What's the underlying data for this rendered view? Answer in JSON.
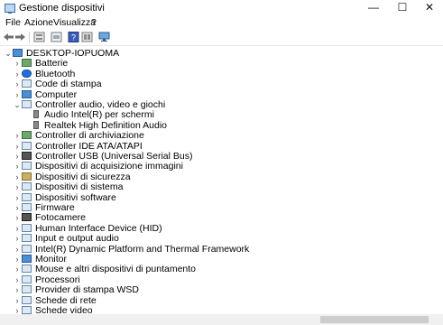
{
  "window": {
    "title": "Gestione dispositivi",
    "buttons": {
      "minimize": "—",
      "maximize": "☐",
      "close": "✕"
    }
  },
  "menu": [
    "File",
    "Azione",
    "Visualizza",
    "?"
  ],
  "toolbar": [
    "back-icon",
    "forward-icon",
    "properties-icon",
    "update-driver-icon",
    "help-icon",
    "view-icon",
    "monitor-icon"
  ],
  "tree": {
    "root": "DESKTOP-IOPUOMA",
    "items": [
      {
        "label": "Batterie",
        "expanded": false,
        "icon": "battery-icon"
      },
      {
        "label": "Bluetooth",
        "expanded": false,
        "icon": "bluetooth-icon"
      },
      {
        "label": "Code di stampa",
        "expanded": false,
        "icon": "print-queue-icon"
      },
      {
        "label": "Computer",
        "expanded": false,
        "icon": "computer-icon"
      },
      {
        "label": "Controller audio, video e giochi",
        "expanded": true,
        "icon": "audio-controller-icon",
        "children": [
          "Audio Intel(R) per schermi",
          "Realtek High Definition Audio"
        ]
      },
      {
        "label": "Controller di archiviazione",
        "expanded": false,
        "icon": "storage-controller-icon"
      },
      {
        "label": "Controller IDE ATA/ATAPI",
        "expanded": false,
        "icon": "ide-controller-icon"
      },
      {
        "label": "Controller USB (Universal Serial Bus)",
        "expanded": false,
        "icon": "usb-controller-icon"
      },
      {
        "label": "Dispositivi di acquisizione immagini",
        "expanded": false,
        "icon": "camera-device-icon"
      },
      {
        "label": "Dispositivi di sicurezza",
        "expanded": false,
        "icon": "security-device-icon"
      },
      {
        "label": "Dispositivi di sistema",
        "expanded": false,
        "icon": "system-device-icon"
      },
      {
        "label": "Dispositivi software",
        "expanded": false,
        "icon": "software-device-icon"
      },
      {
        "label": "Firmware",
        "expanded": false,
        "icon": "firmware-icon"
      },
      {
        "label": "Fotocamere",
        "expanded": false,
        "icon": "camera-icon"
      },
      {
        "label": "Human Interface Device (HID)",
        "expanded": false,
        "icon": "hid-icon"
      },
      {
        "label": "Input e output audio",
        "expanded": false,
        "icon": "audio-io-icon"
      },
      {
        "label": "Intel(R) Dynamic Platform and Thermal Framework",
        "expanded": false,
        "icon": "thermal-icon"
      },
      {
        "label": "Monitor",
        "expanded": false,
        "icon": "monitor-icon"
      },
      {
        "label": "Mouse e altri dispositivi di puntamento",
        "expanded": false,
        "icon": "mouse-icon"
      },
      {
        "label": "Processori",
        "expanded": false,
        "icon": "processor-icon"
      },
      {
        "label": "Provider di stampa WSD",
        "expanded": false,
        "icon": "wsd-printer-icon"
      },
      {
        "label": "Schede di rete",
        "expanded": false,
        "icon": "network-adapter-icon"
      },
      {
        "label": "Schede video",
        "expanded": false,
        "icon": "display-adapter-icon"
      }
    ]
  }
}
